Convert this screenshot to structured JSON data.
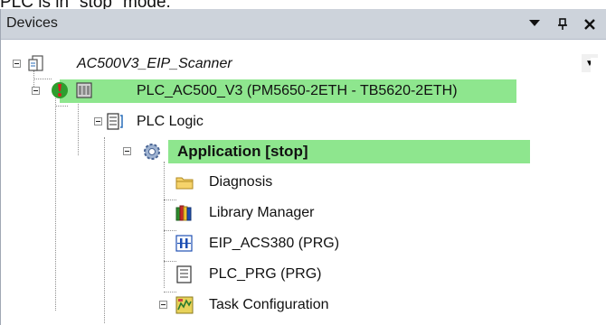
{
  "caption": "PLC is in \"stop\" mode.",
  "panel": {
    "title": "Devices",
    "buttons": {
      "menu": "▼",
      "pin": "ᵍ",
      "close": "✕"
    }
  },
  "tree": [
    {
      "label": "AC500V3_EIP_Scanner",
      "icon": "project-icon",
      "style": "italic"
    },
    {
      "label": "PLC_AC500_V3 (PM5650-2ETH - TB5620-2ETH)",
      "icon": "plc-device-icon",
      "status_icon": "status-running-icon",
      "highlight": true
    },
    {
      "label": "PLC Logic",
      "icon": "plc-logic-icon"
    },
    {
      "label": "Application [stop]",
      "icon": "application-gear-icon",
      "style": "bold",
      "highlight": true
    },
    {
      "label": "Diagnosis",
      "icon": "folder-icon"
    },
    {
      "label": "Library Manager",
      "icon": "library-books-icon"
    },
    {
      "label": "EIP_ACS380 (PRG)",
      "icon": "program-blue-icon"
    },
    {
      "label": "PLC_PRG (PRG)",
      "icon": "program-document-icon"
    },
    {
      "label": "Task Configuration",
      "icon": "task-configuration-icon"
    }
  ],
  "colors": {
    "highlight": "#8ee68e",
    "titlebar": "#cdd3db"
  }
}
